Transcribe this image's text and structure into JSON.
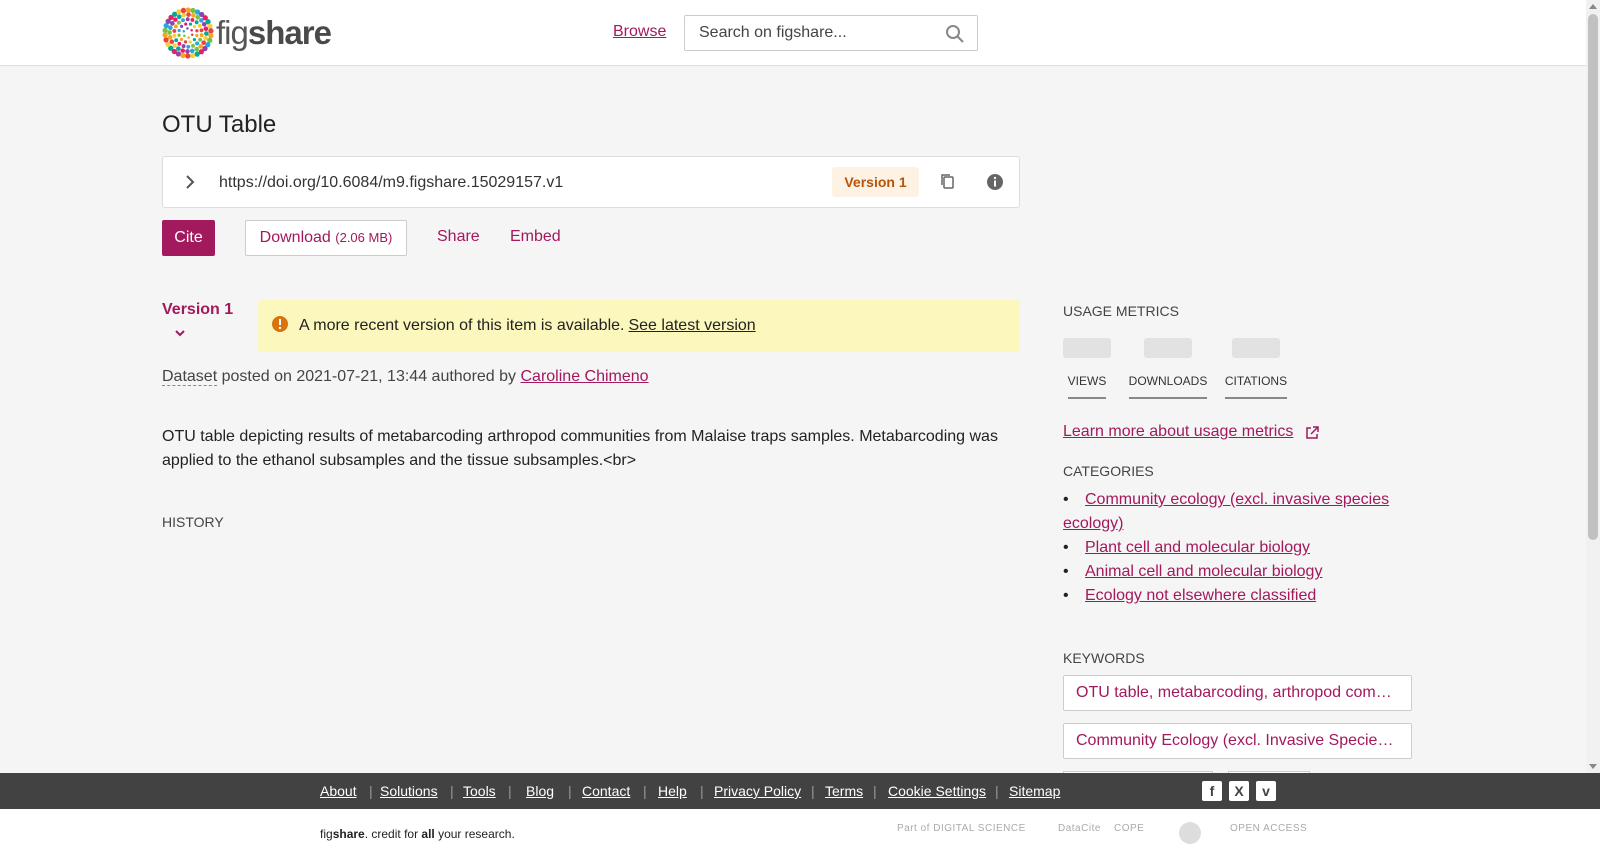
{
  "header": {
    "logo_text": "figshare",
    "browse_label": "Browse",
    "search_placeholder": "Search on figshare..."
  },
  "item": {
    "title": "OTU Table",
    "doi": "https://doi.org/10.6084/m9.figshare.15029157.v1",
    "version_badge": "Version 1"
  },
  "actions": {
    "cite": "Cite",
    "download": "Download",
    "download_size": "(2.06 MB)",
    "share": "Share",
    "embed": "Embed"
  },
  "version": {
    "label": "Version 1",
    "notice": "A more recent version of this item is available.",
    "notice_link": "See latest version"
  },
  "meta": {
    "type": "Dataset",
    "posted": "posted on 2021-07-21, 13:44 authored by",
    "author": "Caroline Chimeno"
  },
  "description": "OTU table depicting results of metabarcoding arthropod communities from Malaise traps samples. Metabarcoding was applied to the ethanol subsamples and the tissue subsamples.<br>",
  "history_heading": "HISTORY",
  "sidebar": {
    "usage_heading": "USAGE METRICS",
    "metrics": [
      "VIEWS",
      "DOWNLOADS",
      "CITATIONS"
    ],
    "learn_more": "Learn more about usage metrics",
    "categories_heading": "CATEGORIES",
    "categories": [
      "Community ecology (excl. invasive species ecology)",
      "Plant cell and molecular biology",
      "Animal cell and molecular biology",
      "Ecology not elsewhere classified"
    ],
    "keywords_heading": "KEYWORDS",
    "keywords": [
      "OTU table, metabarcoding, arthropod com…",
      "Community Ecology (excl. Invasive Specie…"
    ]
  },
  "footer": {
    "links": [
      "About",
      "Solutions",
      "Tools",
      "Blog",
      "Contact",
      "Help",
      "Privacy Policy",
      "Terms",
      "Cookie Settings",
      "Sitemap"
    ],
    "credit_fig": "fig",
    "credit_share": "share",
    "credit_mid": ". credit for ",
    "credit_all": "all",
    "credit_end": " your research.",
    "partners": [
      "Part of DIGITAL SCIENCE",
      "DataCite",
      "COPE",
      "",
      "OPEN ACCESS"
    ]
  },
  "colors": {
    "brand": "#a2195d",
    "notice_bg": "#fcf7bc",
    "version_badge": "#b8540a"
  }
}
